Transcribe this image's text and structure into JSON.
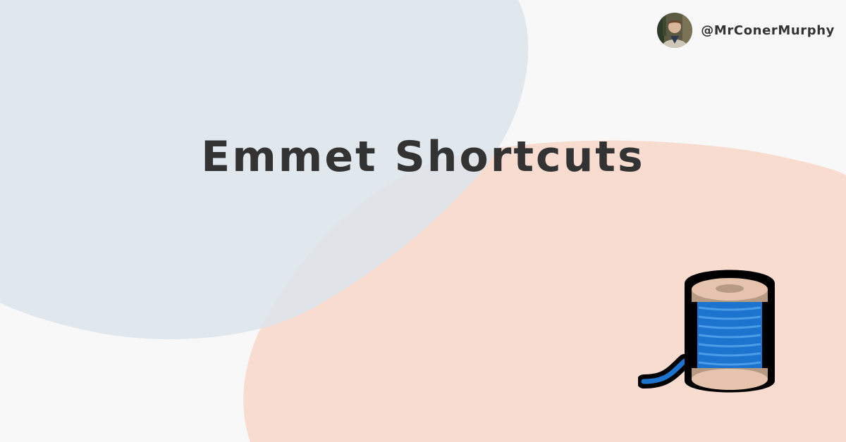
{
  "card": {
    "title": "Emmet Shortcuts",
    "author_handle": "@MrConerMurphy"
  },
  "icons": {
    "avatar": "author-avatar-photo",
    "illustration": "spool-of-thread-icon"
  },
  "colors": {
    "background": "#f8f8f8",
    "blob_blue": "#dce4eb",
    "blob_peach": "#f8dccf",
    "text": "#333333",
    "thread_blue": "#1c74cf",
    "spool_wood": "#e5c3ac"
  }
}
